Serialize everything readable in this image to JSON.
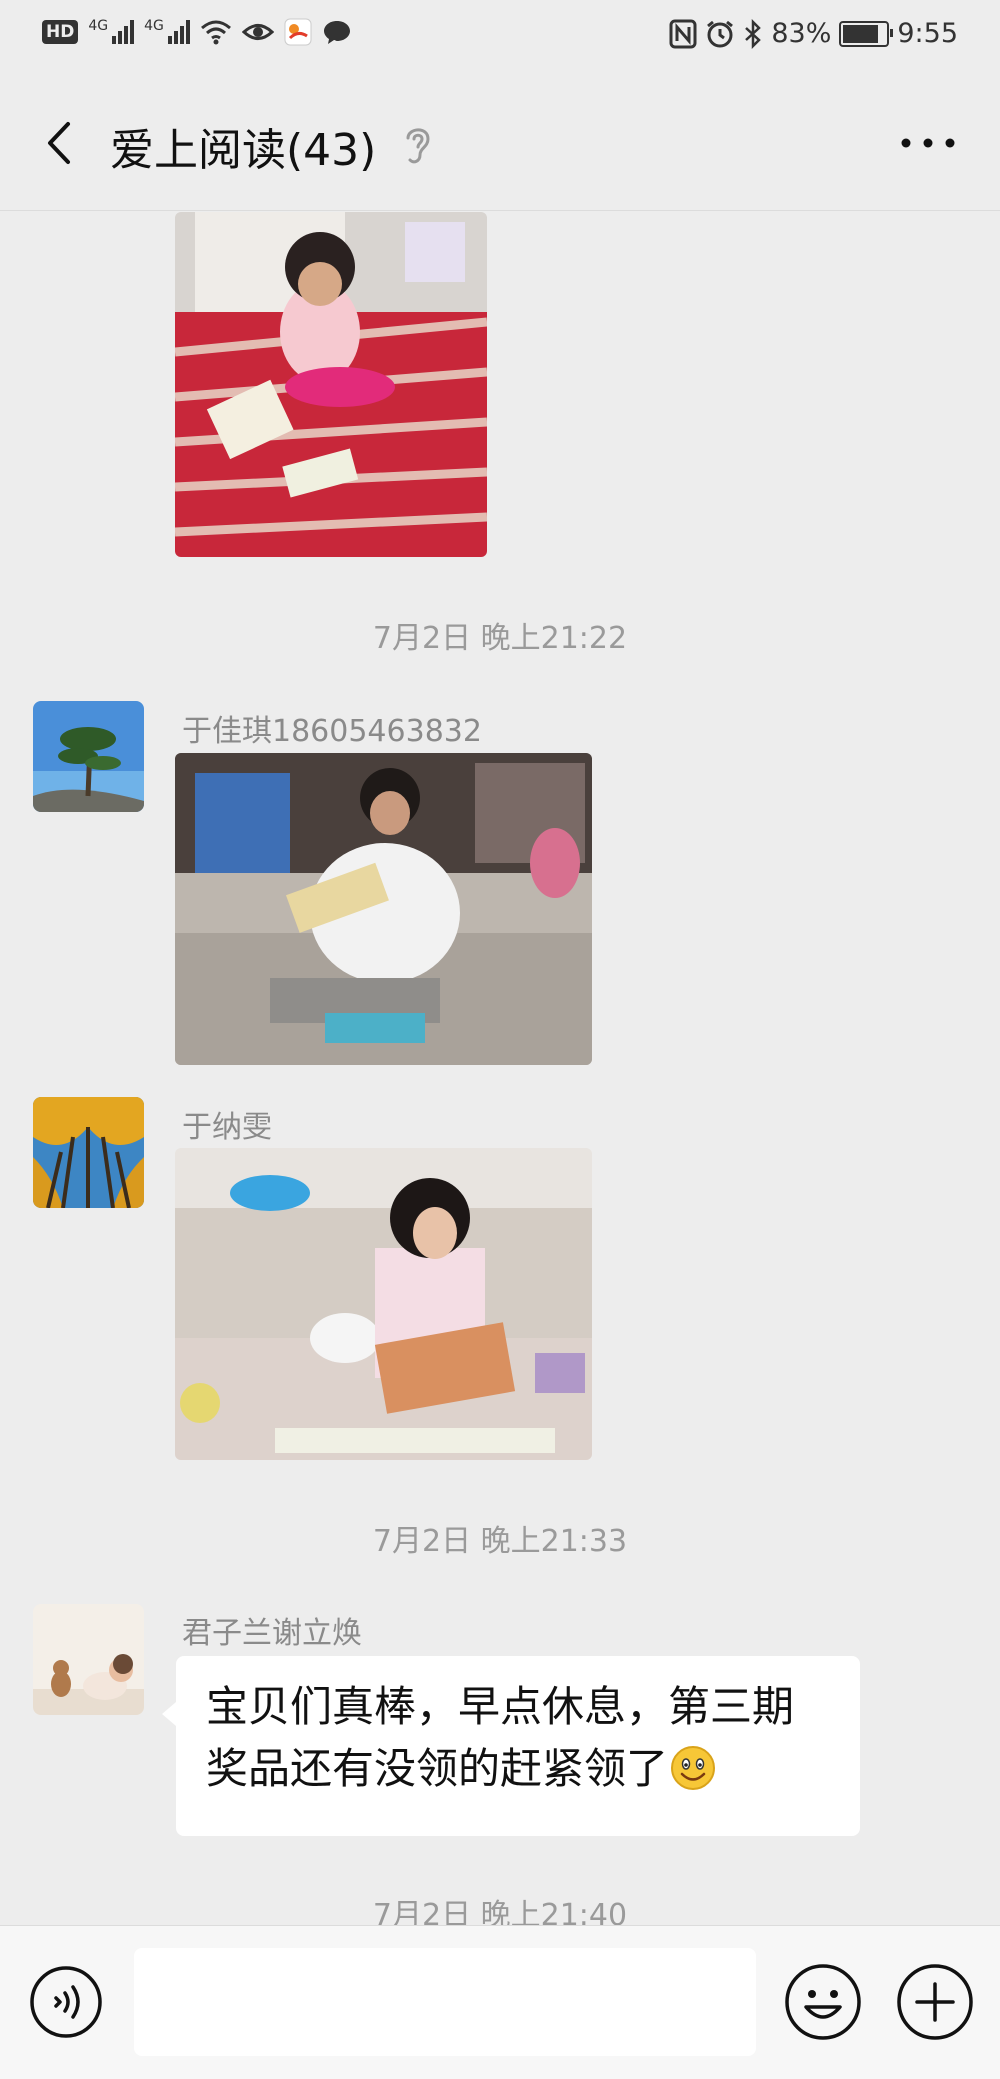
{
  "status_bar": {
    "hd_label": "HD",
    "network_1": "4G",
    "network_2": "4G",
    "battery_percent": "83%",
    "battery_level": 0.83,
    "time": "9:55"
  },
  "header": {
    "title": "爱上阅读(43)"
  },
  "messages": {
    "timestamp_1": "7月2日 晚上21:22",
    "sender_1": "于佳琪18605463832",
    "sender_2": "于纳雯",
    "timestamp_2": "7月2日 晚上21:33",
    "sender_3": "君子兰谢立焕",
    "text_3": "宝贝们真棒，早点休息，第三期奖品还有没领的赶紧领了",
    "timestamp_3": "7月2日 晚上21:40"
  },
  "icons": {
    "back": "back-arrow-icon",
    "ear": "ear-icon",
    "more": "more-icon",
    "voice": "voice-icon",
    "emoji": "emoji-icon",
    "plus": "plus-icon"
  },
  "colors": {
    "background": "#ededed",
    "bubble": "#ffffff",
    "timestamp": "#9a9a9a",
    "sender": "#8a8a8a"
  },
  "input": {
    "value": ""
  }
}
